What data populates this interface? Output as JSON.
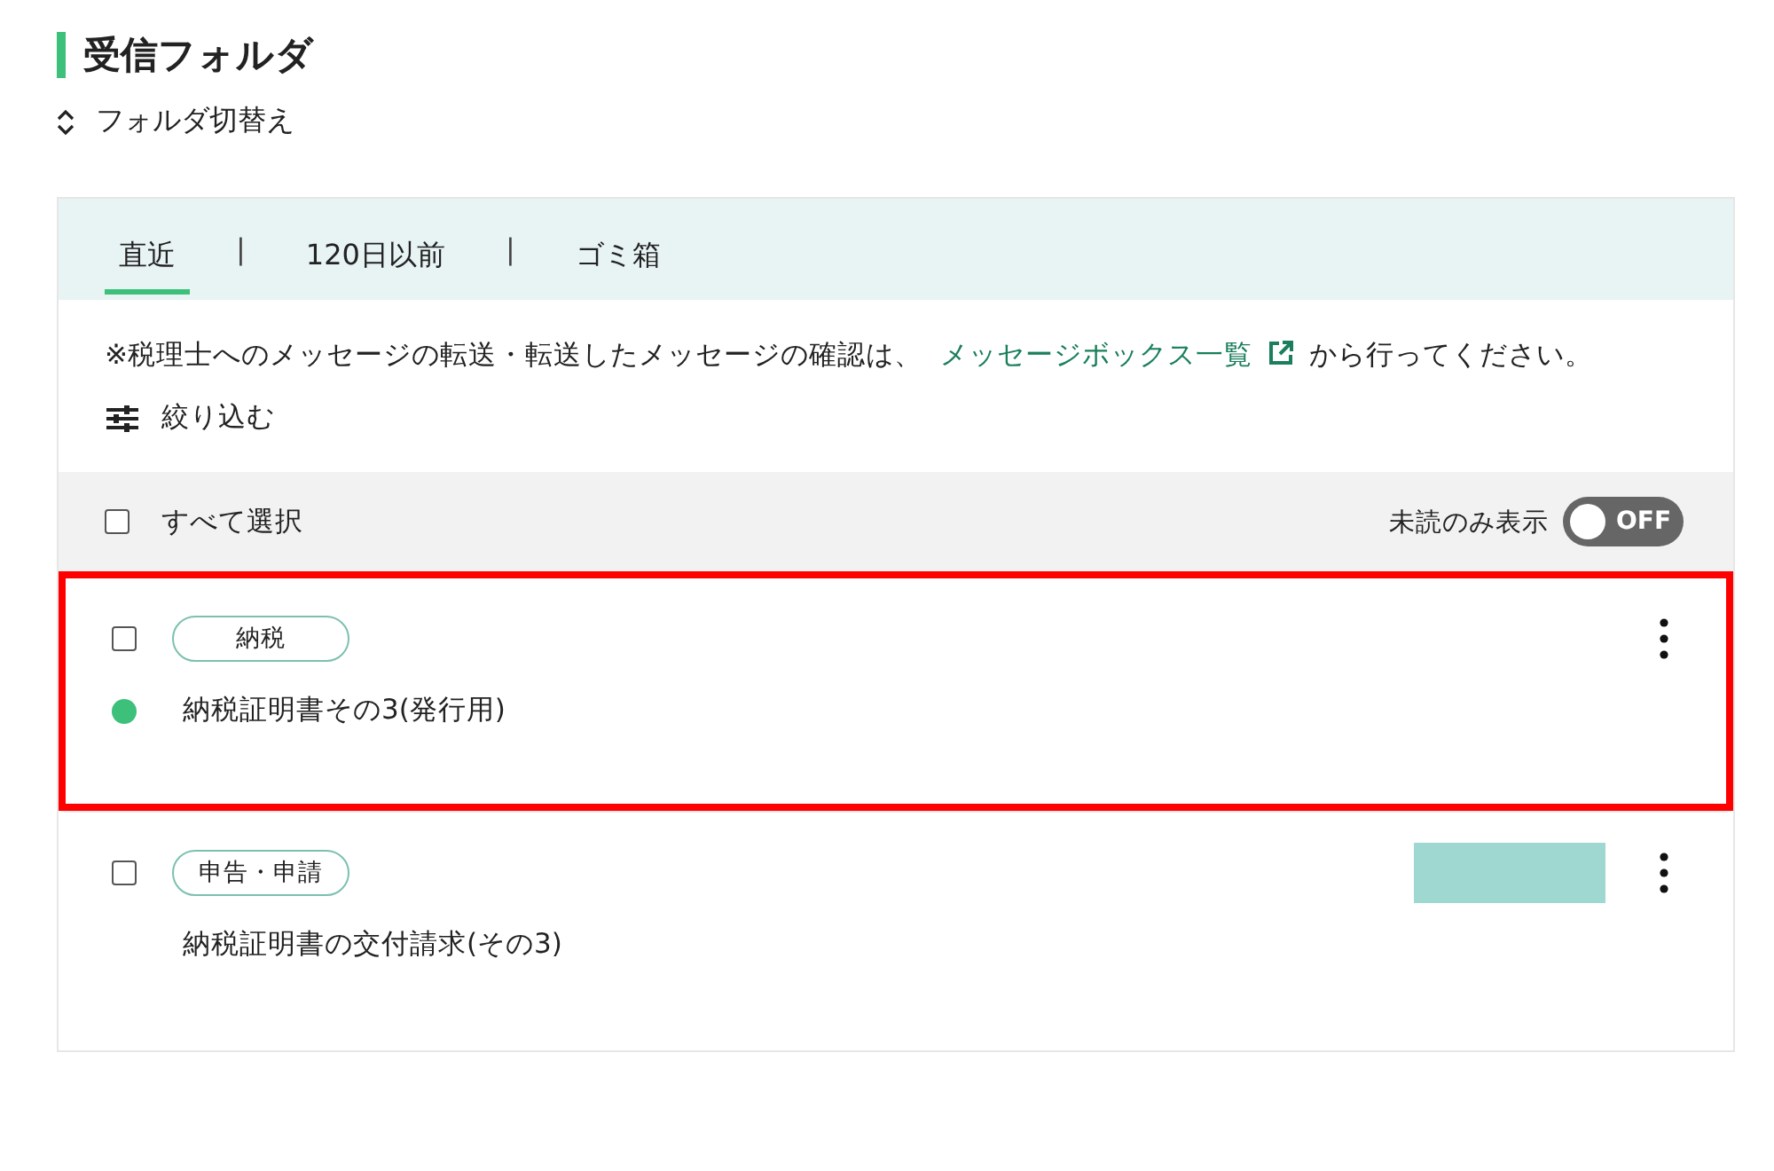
{
  "page_title": "受信フォルダ",
  "folder_switch": {
    "label": "フォルダ切替え"
  },
  "tabs": [
    {
      "label": "直近",
      "selected": true
    },
    {
      "label": "120日以前",
      "selected": false
    },
    {
      "label": "ゴミ箱",
      "selected": false
    }
  ],
  "tab_separator": "|",
  "notice": {
    "before": "※税理士へのメッセージの転送・転送したメッセージの確認は、",
    "link": "メッセージボックス一覧",
    "after": "から行ってください。"
  },
  "filter": {
    "label": "絞り込む"
  },
  "list_header": {
    "select_all": {
      "label": "すべて選択",
      "checked": false
    },
    "unread_only": {
      "label": "未読のみ表示",
      "on": false,
      "state_text": "OFF"
    }
  },
  "messages": [
    {
      "tag": "納税",
      "title": "納税証明書その3(発行用)",
      "checked": false,
      "unread": true,
      "highlighted": true,
      "status_block": false
    },
    {
      "tag": "申告・申請",
      "title": "納税証明書の交付請求(その3)",
      "checked": false,
      "unread": false,
      "highlighted": false,
      "status_block": true
    }
  ]
}
